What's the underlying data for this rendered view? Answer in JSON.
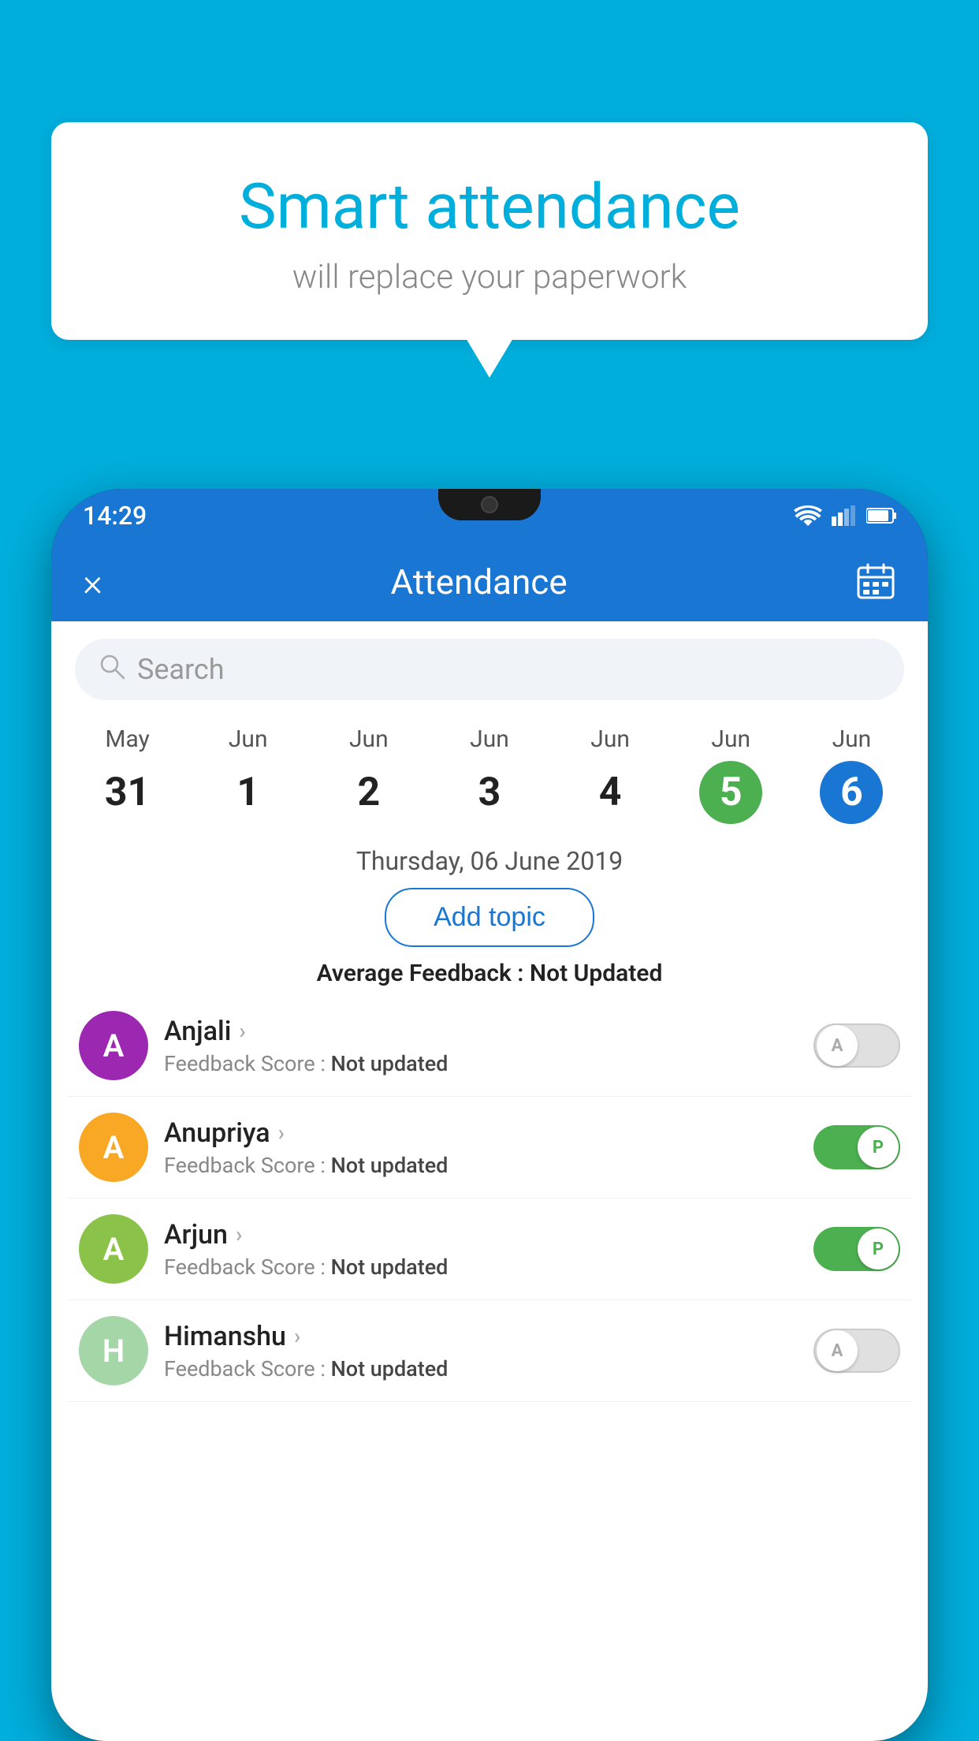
{
  "background_color": "#00AEDC",
  "bubble": {
    "title": "Smart attendance",
    "subtitle": "will replace your paperwork"
  },
  "status_bar": {
    "time": "14:29",
    "wifi_icon": "wifi",
    "signal_icon": "signal",
    "battery_icon": "battery"
  },
  "header": {
    "title": "Attendance",
    "close_icon": "×",
    "calendar_icon": "📅"
  },
  "search": {
    "placeholder": "Search"
  },
  "calendar": {
    "days": [
      {
        "month": "May",
        "date": "31",
        "state": "normal"
      },
      {
        "month": "Jun",
        "date": "1",
        "state": "normal"
      },
      {
        "month": "Jun",
        "date": "2",
        "state": "normal"
      },
      {
        "month": "Jun",
        "date": "3",
        "state": "normal"
      },
      {
        "month": "Jun",
        "date": "4",
        "state": "normal"
      },
      {
        "month": "Jun",
        "date": "5",
        "state": "today"
      },
      {
        "month": "Jun",
        "date": "6",
        "state": "selected"
      }
    ]
  },
  "selected_date": "Thursday, 06 June 2019",
  "add_topic_label": "Add topic",
  "average_feedback": {
    "label": "Average Feedback : ",
    "value": "Not Updated"
  },
  "students": [
    {
      "name": "Anjali",
      "avatar_letter": "A",
      "avatar_color": "#9C27B0",
      "feedback_label": "Feedback Score : ",
      "feedback_value": "Not updated",
      "toggle_state": "off",
      "toggle_letter": "A"
    },
    {
      "name": "Anupriya",
      "avatar_letter": "A",
      "avatar_color": "#F9A825",
      "feedback_label": "Feedback Score : ",
      "feedback_value": "Not updated",
      "toggle_state": "on",
      "toggle_letter": "P"
    },
    {
      "name": "Arjun",
      "avatar_letter": "A",
      "avatar_color": "#8BC34A",
      "feedback_label": "Feedback Score : ",
      "feedback_value": "Not updated",
      "toggle_state": "on",
      "toggle_letter": "P"
    },
    {
      "name": "Himanshu",
      "avatar_letter": "H",
      "avatar_color": "#A5D6A7",
      "feedback_label": "Feedback Score : ",
      "feedback_value": "Not updated",
      "toggle_state": "off",
      "toggle_letter": "A"
    }
  ]
}
